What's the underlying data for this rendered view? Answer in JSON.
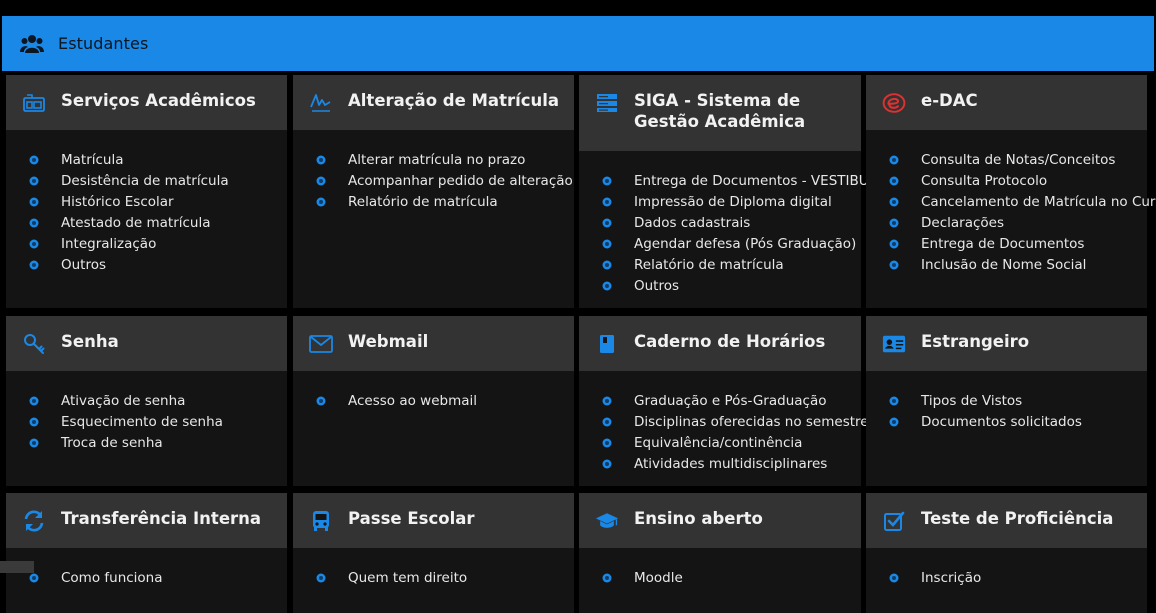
{
  "header": {
    "title": "Estudantes",
    "icon": "users-icon"
  },
  "accent": "#1a88e6",
  "cards": [
    {
      "id": "servicos",
      "icon": "id-card-icon",
      "title": "Serviços Acadêmicos",
      "items": [
        "Matrícula",
        "Desistência de matrícula",
        "Histórico Escolar",
        "Atestado de matrícula",
        "Integralização",
        "Outros"
      ]
    },
    {
      "id": "alteracao",
      "icon": "signature-icon",
      "title": "Alteração de Matrícula",
      "items": [
        "Alterar matrícula no prazo",
        "Acompanhar pedido de alteração",
        "Relatório de matrícula"
      ]
    },
    {
      "id": "siga",
      "icon": "server-icon",
      "title": "SIGA - Sistema de Gestão Acadêmica",
      "items": [
        "Entrega de Documentos - VESTIBULAR",
        "Impressão de Diploma digital",
        "Dados cadastrais",
        "Agendar defesa (Pós Graduação)",
        "Relatório de matrícula",
        "Outros"
      ]
    },
    {
      "id": "edac",
      "icon": "edac-logo-icon",
      "title": "e-DAC",
      "items": [
        "Consulta de Notas/Conceitos",
        "Consulta Protocolo",
        "Cancelamento de Matrícula no Curso",
        "Declarações",
        "Entrega de Documentos",
        "Inclusão de Nome Social"
      ]
    },
    {
      "id": "senha",
      "icon": "key-icon",
      "title": "Senha",
      "items": [
        "Ativação de senha",
        "Esquecimento de senha",
        "Troca de senha"
      ]
    },
    {
      "id": "webmail",
      "icon": "envelope-icon",
      "title": "Webmail",
      "items": [
        "Acesso ao webmail"
      ]
    },
    {
      "id": "caderno",
      "icon": "book-icon",
      "title": "Caderno de Horários",
      "items": [
        "Graduação e Pós-Graduação",
        "Disciplinas oferecidas no semestre",
        "Equivalência/continência",
        "Atividades multidisciplinares"
      ]
    },
    {
      "id": "estrangeiro",
      "icon": "passport-card-icon",
      "title": "Estrangeiro",
      "items": [
        "Tipos de Vistos",
        "Documentos solicitados"
      ]
    },
    {
      "id": "transferencia",
      "icon": "sync-icon",
      "title": "Transferência Interna",
      "items": [
        "Como funciona"
      ]
    },
    {
      "id": "passe",
      "icon": "bus-icon",
      "title": "Passe Escolar",
      "items": [
        "Quem tem direito"
      ]
    },
    {
      "id": "ensino",
      "icon": "graduation-cap-icon",
      "title": "Ensino aberto",
      "items": [
        "Moodle"
      ]
    },
    {
      "id": "teste",
      "icon": "check-square-icon",
      "title": "Teste de Proficiência",
      "items": [
        "Inscrição"
      ]
    }
  ]
}
